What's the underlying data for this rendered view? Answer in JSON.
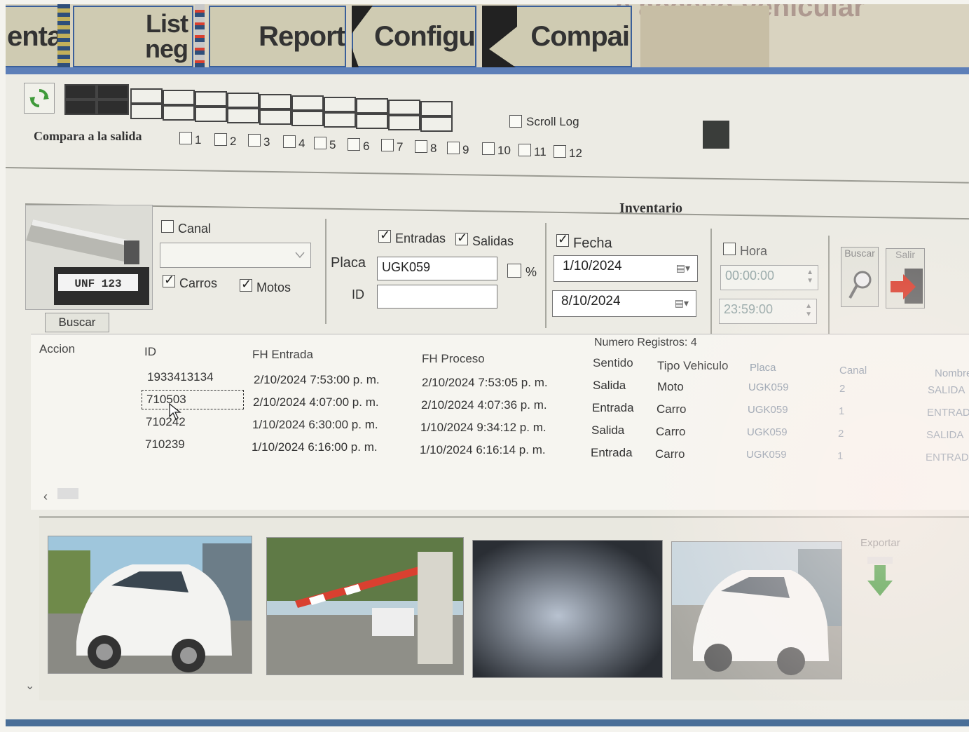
{
  "window": {
    "title_ghost": "e acceso vehicular"
  },
  "tabs": [
    {
      "label": "enta"
    },
    {
      "label_line1": "List",
      "label_line2": "neg"
    },
    {
      "label": "Report"
    },
    {
      "label": "Configu"
    },
    {
      "label": "Compai"
    },
    {
      "label": ""
    }
  ],
  "toolbar": {
    "refresh_icon": "refresh-icon"
  },
  "compara": {
    "label": "Compara a la salida",
    "options": [
      "1",
      "2",
      "3",
      "4",
      "5",
      "6",
      "7",
      "8",
      "9",
      "10",
      "11",
      "12"
    ]
  },
  "scroll_log": {
    "label": "Scroll Log",
    "checked": false
  },
  "inventario": {
    "title": "Inventario",
    "canal_label": "Canal",
    "canal_checked": false,
    "carros_label": "Carros",
    "motos_label": "Motos",
    "placa_label": "Placa",
    "placa_value": "UGK059",
    "percent_label": "%",
    "id_label": "ID",
    "id_value": "",
    "entradas_label": "Entradas",
    "salidas_label": "Salidas",
    "fecha_label": "Fecha",
    "fecha_desde": "1/10/2024",
    "fecha_hasta": "8/10/2024",
    "hora_label": "Hora",
    "hora_desde": "00:00:00",
    "hora_hasta": "23:59:00",
    "buscar_btn": "Buscar",
    "salir_btn": "Salir",
    "buscar_tab": "Buscar",
    "camera_plate": "UNF 123"
  },
  "table": {
    "numero_registros": "Numero Registros: 4",
    "headers": [
      "Accion",
      "ID",
      "FH Entrada",
      "FH Proceso",
      "Sentido",
      "Tipo Vehiculo",
      "Placa",
      "Canal",
      "Nombre"
    ],
    "rows": [
      {
        "id": "1933413134",
        "fh_entrada": "2/10/2024 7:53:00 p. m.",
        "fh_proceso": "2/10/2024 7:53:05 p. m.",
        "sentido": "Salida",
        "tipo": "Moto",
        "placa": "UGK059",
        "canal": "2",
        "nombre": "SALIDA"
      },
      {
        "id": "710503",
        "fh_entrada": "2/10/2024 4:07:00 p. m.",
        "fh_proceso": "2/10/2024 4:07:36 p. m.",
        "sentido": "Entrada",
        "tipo": "Carro",
        "placa": "UGK059",
        "canal": "1",
        "nombre": "ENTRAD"
      },
      {
        "id": "710242",
        "fh_entrada": "1/10/2024 6:30:00 p. m.",
        "fh_proceso": "1/10/2024 9:34:12 p. m.",
        "sentido": "Salida",
        "tipo": "Carro",
        "placa": "UGK059",
        "canal": "2",
        "nombre": "SALIDA"
      },
      {
        "id": "710239",
        "fh_entrada": "1/10/2024 6:16:00 p. m.",
        "fh_proceso": "1/10/2024 6:16:14 p. m.",
        "sentido": "Entrada",
        "tipo": "Carro",
        "placa": "UGK059",
        "canal": "1",
        "nombre": "ENTRADA"
      }
    ]
  },
  "images": {
    "export_label": "Exportar"
  },
  "colors": {
    "accent_blue": "#3a5f9a",
    "tab_bg": "#cfcbb2",
    "arrow_green": "#3f9a3a",
    "arrow_red": "#d94030"
  }
}
